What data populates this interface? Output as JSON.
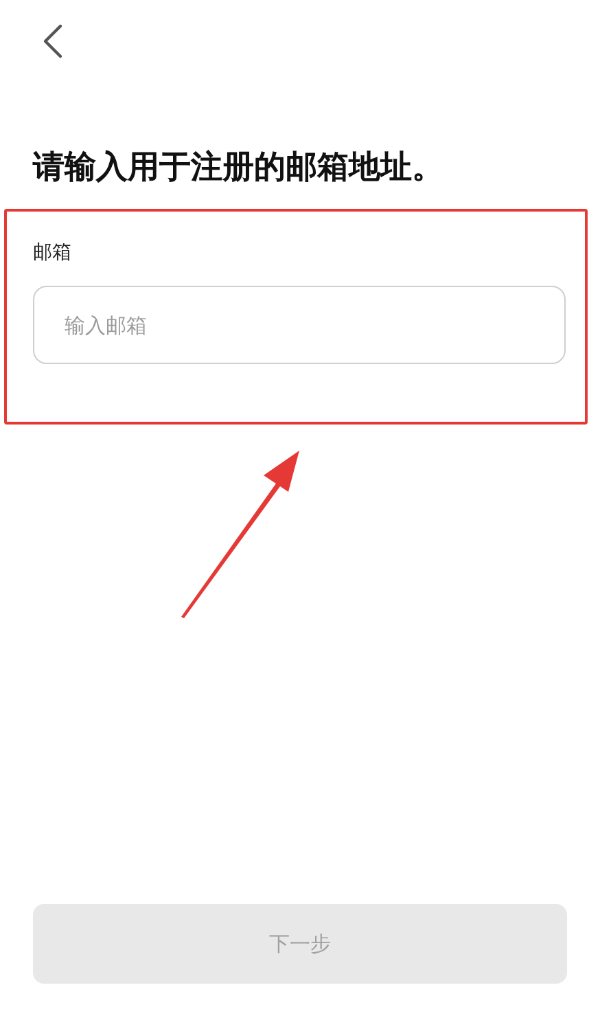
{
  "title": "请输入用于注册的邮箱地址。",
  "email_field": {
    "label": "邮箱",
    "placeholder": "输入邮箱"
  },
  "next_button": {
    "label": "下一步",
    "disabled": true
  }
}
